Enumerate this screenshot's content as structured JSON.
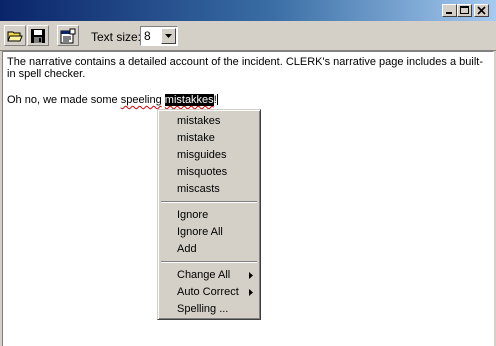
{
  "toolbar": {
    "open_icon": "open-folder-icon",
    "save_icon": "save-disk-icon",
    "properties_icon": "properties-icon",
    "text_size_label": "Text size:",
    "text_size_value": "8"
  },
  "window_buttons": [
    "minimize-icon",
    "maximize-icon",
    "close-icon"
  ],
  "editor": {
    "paragraph1": "The narrative contains a detailed account of the incident.  CLERK's narrative page includes a built-in spell checker.",
    "paragraph2_before": "Oh no, we made some ",
    "misspelled_word1": "speeling",
    "paragraph2_space": " ",
    "misspelled_word2_selected": "mistakkes",
    "paragraph2_end": "!"
  },
  "context_menu": {
    "suggestions": [
      "mistakes",
      "mistake",
      "misguides",
      "misquotes",
      "miscasts"
    ],
    "actions": [
      "Ignore",
      "Ignore All",
      "Add"
    ],
    "submenus": [
      {
        "label": "Change All",
        "has_submenu": true
      },
      {
        "label": "Auto Correct",
        "has_submenu": true
      },
      {
        "label": "Spelling ...",
        "has_submenu": false
      }
    ]
  },
  "colors": {
    "titlebar_start": "#0a246a",
    "titlebar_end": "#a6caf0",
    "face": "#d4d0c8",
    "misspelling_underline": "#e00000"
  }
}
